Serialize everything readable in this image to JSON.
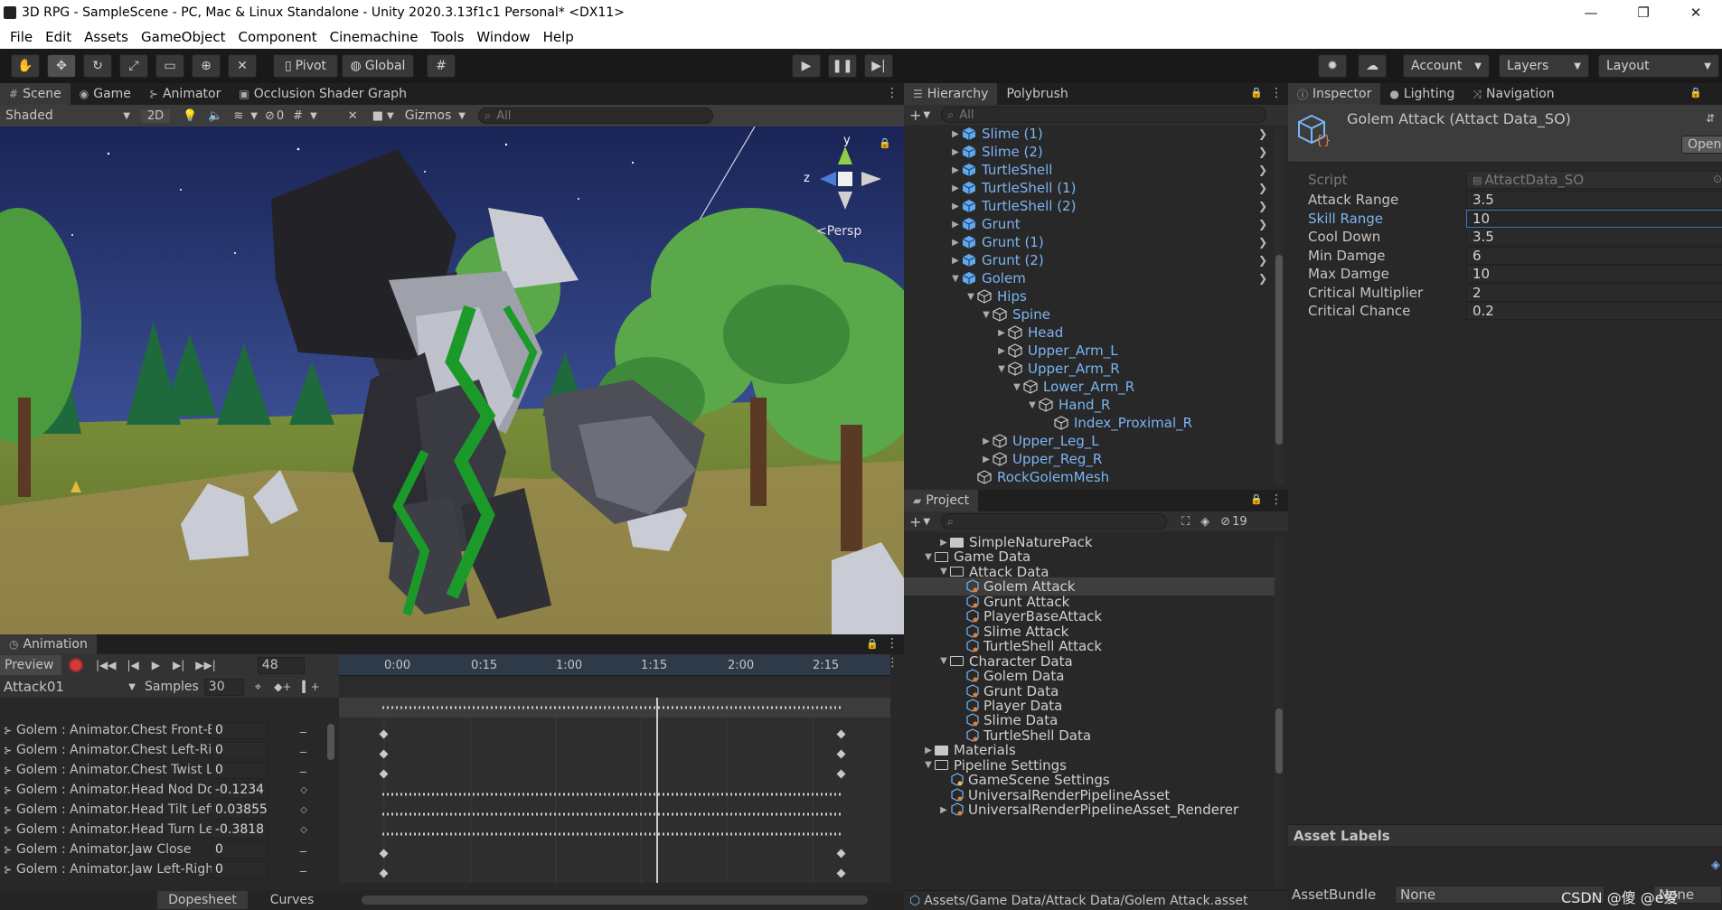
{
  "window": {
    "title": "3D RPG - SampleScene - PC, Mac & Linux Standalone - Unity 2020.3.13f1c1 Personal* <DX11>",
    "minimize": "—",
    "maximize": "❐",
    "close": "✕"
  },
  "menu": [
    "File",
    "Edit",
    "Assets",
    "GameObject",
    "Component",
    "Cinemachine",
    "Tools",
    "Window",
    "Help"
  ],
  "toolbar": {
    "pivot": "Pivot",
    "global": "Global",
    "account": "Account",
    "layers": "Layers",
    "layout": "Layout"
  },
  "scene": {
    "tabs": [
      "Scene",
      "Game",
      "Animator",
      "Occlusion Shader Graph"
    ],
    "shading": "Shaded",
    "mode_2d": "2D",
    "hidden_count": "0",
    "gizmos": "Gizmos",
    "search_placeholder": "All",
    "persp": "<Persp",
    "axis_y": "y",
    "axis_z": "z"
  },
  "animation": {
    "tab": "Animation",
    "preview": "Preview",
    "frame": "48",
    "clip": "Attack01",
    "samples_label": "Samples",
    "samples": "30",
    "ticks": [
      "0:00",
      "0:15",
      "1:00",
      "1:15",
      "2:00",
      "2:15"
    ],
    "properties": [
      {
        "name": "Golem : Animator.Chest Front-Back",
        "value": "0"
      },
      {
        "name": "Golem : Animator.Chest Left-Right",
        "value": "0"
      },
      {
        "name": "Golem : Animator.Chest Twist Left-Right",
        "value": "0"
      },
      {
        "name": "Golem : Animator.Head Nod Down-Up",
        "value": "-0.1234"
      },
      {
        "name": "Golem : Animator.Head Tilt Left-Right",
        "value": "0.03855"
      },
      {
        "name": "Golem : Animator.Head Turn Left-Right",
        "value": "-0.3818"
      },
      {
        "name": "Golem : Animator.Jaw Close",
        "value": "0"
      },
      {
        "name": "Golem : Animator.Jaw Left-Right",
        "value": "0"
      }
    ],
    "dopesheet": "Dopesheet",
    "curves": "Curves"
  },
  "hierarchy": {
    "tabs": [
      "Hierarchy",
      "Polybrush"
    ],
    "search_placeholder": "All",
    "items": [
      {
        "label": "Slime (1)",
        "depth": 0,
        "arrow": "▶",
        "kind": "prefab",
        "chev": true
      },
      {
        "label": "Slime (2)",
        "depth": 0,
        "arrow": "▶",
        "kind": "prefab",
        "chev": true
      },
      {
        "label": "TurtleShell",
        "depth": 0,
        "arrow": "▶",
        "kind": "prefab",
        "chev": true
      },
      {
        "label": "TurtleShell (1)",
        "depth": 0,
        "arrow": "▶",
        "kind": "prefab",
        "chev": true
      },
      {
        "label": "TurtleShell (2)",
        "depth": 0,
        "arrow": "▶",
        "kind": "prefab",
        "chev": true
      },
      {
        "label": "Grunt",
        "depth": 0,
        "arrow": "▶",
        "kind": "prefab",
        "chev": true
      },
      {
        "label": "Grunt (1)",
        "depth": 0,
        "arrow": "▶",
        "kind": "prefab",
        "chev": true
      },
      {
        "label": "Grunt (2)",
        "depth": 0,
        "arrow": "▶",
        "kind": "prefab",
        "chev": true
      },
      {
        "label": "Golem",
        "depth": 0,
        "arrow": "▼",
        "kind": "prefab",
        "chev": true
      },
      {
        "label": "Hips",
        "depth": 1,
        "arrow": "▼",
        "kind": "object",
        "chev": false
      },
      {
        "label": "Spine",
        "depth": 2,
        "arrow": "▼",
        "kind": "object",
        "chev": false
      },
      {
        "label": "Head",
        "depth": 3,
        "arrow": "▶",
        "kind": "object",
        "chev": false
      },
      {
        "label": "Upper_Arm_L",
        "depth": 3,
        "arrow": "▶",
        "kind": "object",
        "chev": false
      },
      {
        "label": "Upper_Arm_R",
        "depth": 3,
        "arrow": "▼",
        "kind": "object",
        "chev": false
      },
      {
        "label": "Lower_Arm_R",
        "depth": 4,
        "arrow": "▼",
        "kind": "object",
        "chev": false
      },
      {
        "label": "Hand_R",
        "depth": 5,
        "arrow": "▼",
        "kind": "object",
        "chev": false
      },
      {
        "label": "Index_Proximal_R",
        "depth": 6,
        "arrow": "",
        "kind": "object",
        "chev": false
      },
      {
        "label": "Upper_Leg_L",
        "depth": 2,
        "arrow": "▶",
        "kind": "object",
        "chev": false
      },
      {
        "label": "Upper_Reg_R",
        "depth": 2,
        "arrow": "▶",
        "kind": "object",
        "chev": false
      },
      {
        "label": "RockGolemMesh",
        "depth": 1,
        "arrow": "",
        "kind": "object",
        "chev": false
      }
    ]
  },
  "project": {
    "tab": "Project",
    "hidden_count": "19",
    "items": [
      {
        "label": "SimpleNaturePack",
        "depth": 1,
        "arrow": "▶",
        "kind": "folder"
      },
      {
        "label": "Game Data",
        "depth": 0,
        "arrow": "▼",
        "kind": "folder-open"
      },
      {
        "label": "Attack Data",
        "depth": 1,
        "arrow": "▼",
        "kind": "folder-open"
      },
      {
        "label": "Golem Attack",
        "depth": 2,
        "arrow": "",
        "kind": "so",
        "selected": true
      },
      {
        "label": "Grunt Attack",
        "depth": 2,
        "arrow": "",
        "kind": "so"
      },
      {
        "label": "PlayerBaseAttack",
        "depth": 2,
        "arrow": "",
        "kind": "so"
      },
      {
        "label": "Slime Attack",
        "depth": 2,
        "arrow": "",
        "kind": "so"
      },
      {
        "label": "TurtleShell Attack",
        "depth": 2,
        "arrow": "",
        "kind": "so"
      },
      {
        "label": "Character Data",
        "depth": 1,
        "arrow": "▼",
        "kind": "folder-open"
      },
      {
        "label": "Golem Data",
        "depth": 2,
        "arrow": "",
        "kind": "so"
      },
      {
        "label": "Grunt Data",
        "depth": 2,
        "arrow": "",
        "kind": "so"
      },
      {
        "label": "Player Data",
        "depth": 2,
        "arrow": "",
        "kind": "so"
      },
      {
        "label": "Slime Data",
        "depth": 2,
        "arrow": "",
        "kind": "so"
      },
      {
        "label": "TurtleShell Data",
        "depth": 2,
        "arrow": "",
        "kind": "so"
      },
      {
        "label": "Materials",
        "depth": 0,
        "arrow": "▶",
        "kind": "folder"
      },
      {
        "label": "Pipeline Settings",
        "depth": 0,
        "arrow": "▼",
        "kind": "folder-open"
      },
      {
        "label": "GameScene Settings",
        "depth": 1,
        "arrow": "",
        "kind": "settings"
      },
      {
        "label": "UniversalRenderPipelineAsset",
        "depth": 1,
        "arrow": "",
        "kind": "so"
      },
      {
        "label": "UniversalRenderPipelineAsset_Renderer",
        "depth": 1,
        "arrow": "▶",
        "kind": "so"
      }
    ],
    "path": "Assets/Game Data/Attack Data/Golem Attack.asset"
  },
  "inspector": {
    "tabs": [
      "Inspector",
      "Lighting",
      "Navigation"
    ],
    "title": "Golem Attack (Attact Data_SO)",
    "open": "Open",
    "script_label": "Script",
    "script_value": "AttactData_SO",
    "fields": [
      {
        "label": "Attack Range",
        "value": "3.5"
      },
      {
        "label": "Skill Range",
        "value": "10",
        "focused": true
      },
      {
        "label": "Cool Down",
        "value": "3.5"
      },
      {
        "label": "Min Damge",
        "value": "6"
      },
      {
        "label": "Max Damge",
        "value": "10"
      },
      {
        "label": "Critical Multiplier",
        "value": "2"
      },
      {
        "label": "Critical Chance",
        "value": "0.2"
      }
    ],
    "asset_labels": "Asset Labels",
    "assetbundle_label": "AssetBundle",
    "assetbundle_value": "None",
    "assetbundle_variant": "None",
    "watermark": "CSDN @傻  @e爱"
  },
  "colors": {
    "link_blue": "#7cb4f3",
    "selection": "#2c5d87",
    "panel": "#282828",
    "focus_border": "#3a79bb"
  }
}
